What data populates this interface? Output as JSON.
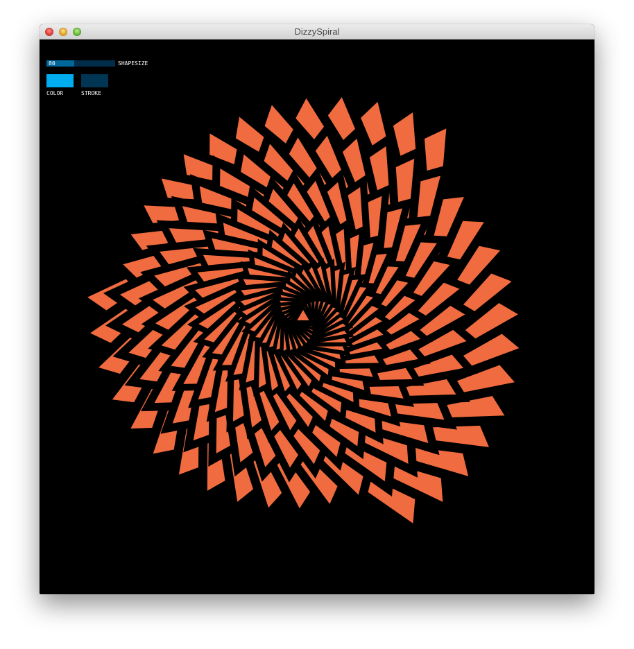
{
  "window": {
    "title": "DizzySpiral"
  },
  "controls": {
    "shapesize": {
      "label": "SHAPESIZE",
      "value": "80",
      "fill_fraction": 0.4
    },
    "color_button": {
      "label": "COLOR",
      "color": "#00aeef"
    },
    "stroke_button": {
      "label": "STROKE",
      "color": "#003553"
    }
  },
  "canvas": {
    "background": "#000000",
    "shape_color": "#f06b3f"
  }
}
